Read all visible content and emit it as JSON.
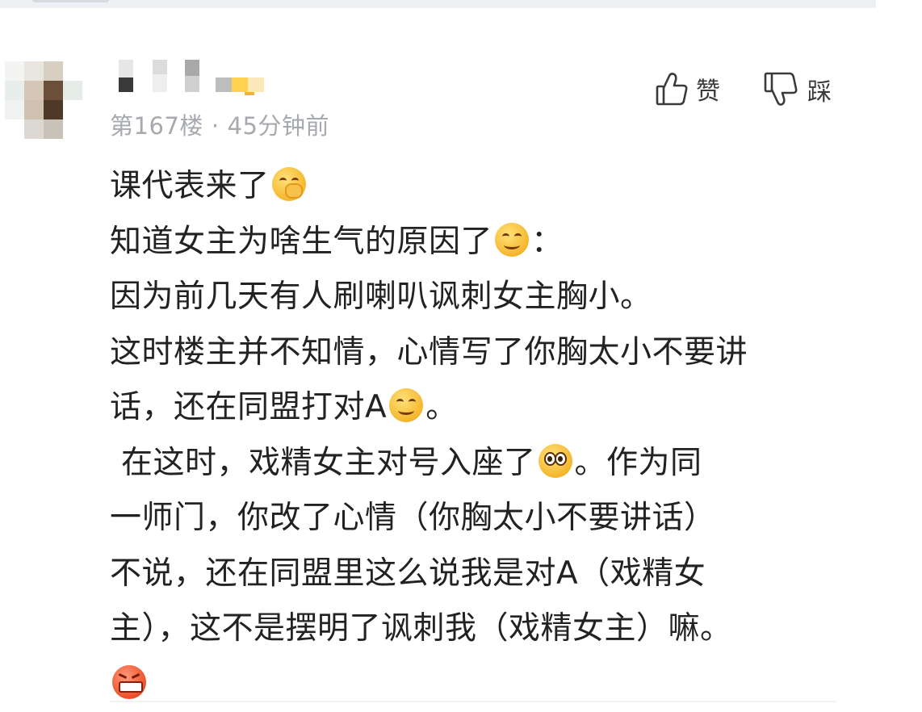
{
  "comment": {
    "floor_meta": "第167楼",
    "time_ago": "45分钟前",
    "separator": "·",
    "actions": {
      "like_label": "赞",
      "dislike_label": "踩"
    },
    "lines": [
      {
        "text": "课代表来了",
        "emoji": "face-covering-mouth-emoji",
        "tail": ""
      },
      {
        "text": "知道女主为啥生气的原因了",
        "emoji": "grinning-face-emoji",
        "tail": "："
      },
      {
        "text": "因为前几天有人刷喇叭讽刺女主胸小。",
        "emoji": null,
        "tail": ""
      },
      {
        "text": "这时楼主并不知情，心情写了你胸太小不要讲",
        "emoji": null,
        "tail": ""
      },
      {
        "text": "话，还在同盟打对A",
        "emoji": "smiling-face-emoji",
        "tail": "。"
      },
      {
        "text": "在这时，戏精女主对号入座了",
        "emoji": "pleading-face-emoji",
        "tail": "。作为同"
      },
      {
        "text": "一师门，你改了心情（你胸太小不要讲话）",
        "emoji": null,
        "tail": ""
      },
      {
        "text": "不说，还在同盟里这么说我是对A（戏精女",
        "emoji": null,
        "tail": ""
      },
      {
        "text": "主），这不是摆明了讽刺我（戏精女主）嘛。",
        "emoji": null,
        "tail": ""
      },
      {
        "text": "",
        "emoji": "angry-face-emoji",
        "tail": ""
      }
    ]
  },
  "colors": {
    "meta_text": "#a6a9ae",
    "body_text": "#222222",
    "action_text": "#3a3a3a"
  }
}
